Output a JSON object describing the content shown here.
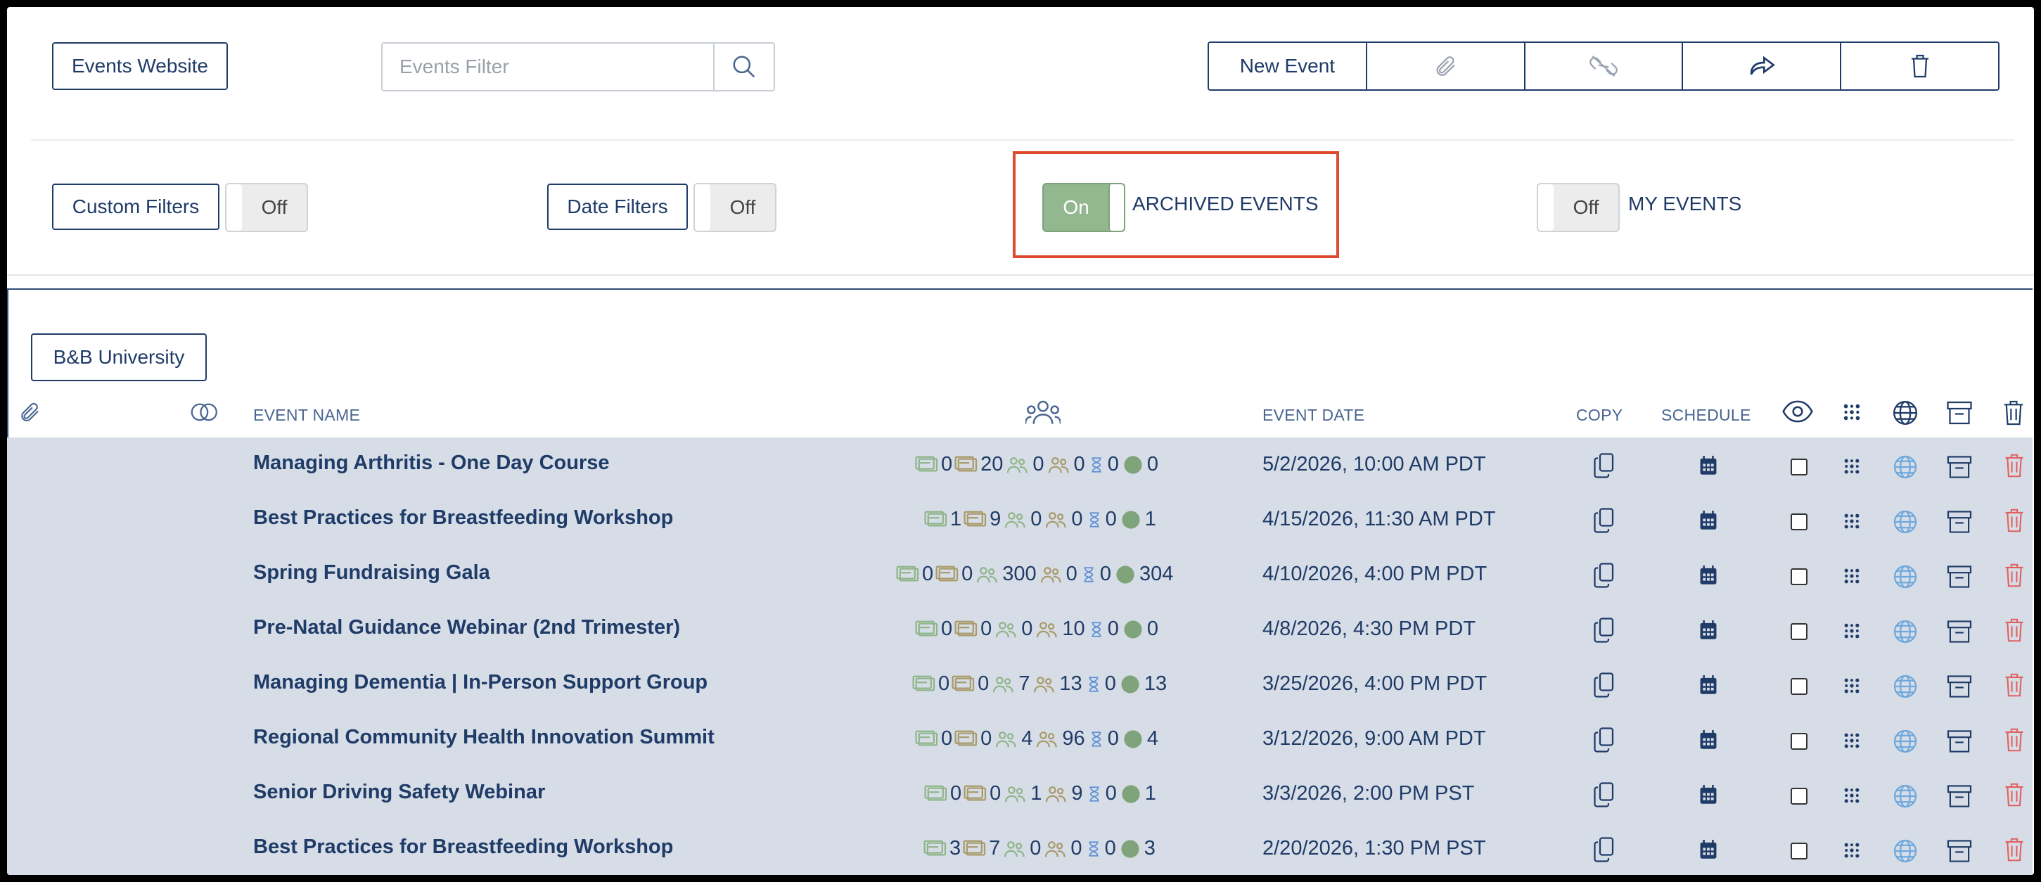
{
  "top": {
    "events_website_label": "Events Website",
    "filter_placeholder": "Events Filter",
    "new_event_label": "New Event"
  },
  "filters": {
    "custom_filters_label": "Custom Filters",
    "custom_filters_state": "Off",
    "date_filters_label": "Date Filters",
    "date_filters_state": "Off",
    "archived_state": "On",
    "archived_label": "ARCHIVED EVENTS",
    "my_events_state": "Off",
    "my_events_label": "MY EVENTS"
  },
  "org_button_label": "B&B University",
  "table": {
    "headers": {
      "event_name": "EVENT NAME",
      "event_date": "EVENT DATE",
      "copy": "COPY",
      "schedule": "SCHEDULE"
    },
    "rows": [
      {
        "name": "Managing Arthritis - One Day Course",
        "counts": [
          "0",
          "20",
          "0",
          "0",
          "0",
          "0"
        ],
        "date": "5/2/2026, 10:00 AM PDT"
      },
      {
        "name": "Best Practices for Breastfeeding Workshop",
        "counts": [
          "1",
          "9",
          "0",
          "0",
          "0",
          "1"
        ],
        "date": "4/15/2026, 11:30 AM PDT"
      },
      {
        "name": "Spring Fundraising Gala",
        "counts": [
          "0",
          "0",
          "300",
          "0",
          "0",
          "304"
        ],
        "date": "4/10/2026, 4:00 PM PDT"
      },
      {
        "name": "Pre-Natal Guidance Webinar (2nd Trimester)",
        "counts": [
          "0",
          "0",
          "0",
          "10",
          "0",
          "0"
        ],
        "date": "4/8/2026, 4:30 PM PDT"
      },
      {
        "name": "Managing Dementia | In-Person Support Group",
        "counts": [
          "0",
          "0",
          "7",
          "13",
          "0",
          "13"
        ],
        "date": "3/25/2026, 4:00 PM PDT"
      },
      {
        "name": "Regional Community Health Innovation Summit",
        "counts": [
          "0",
          "0",
          "4",
          "96",
          "0",
          "4"
        ],
        "date": "3/12/2026, 9:00 AM PDT"
      },
      {
        "name": "Senior Driving Safety Webinar",
        "counts": [
          "0",
          "0",
          "1",
          "9",
          "0",
          "1"
        ],
        "date": "3/3/2026, 2:00 PM PST"
      },
      {
        "name": "Best Practices for Breastfeeding Workshop",
        "counts": [
          "3",
          "7",
          "0",
          "0",
          "0",
          "3"
        ],
        "date": "2/20/2026, 1:30 PM PST"
      }
    ]
  },
  "colors": {
    "primary": "#1f3b68",
    "toggle_on": "#93b78f",
    "highlight_border": "#e04a2f",
    "row_bg": "#d7dde6",
    "globe": "#6fa8dc",
    "trash_row": "#e06060"
  },
  "icons": {
    "search": "search-icon",
    "attach": "paperclip-icon",
    "unlink": "unlink-icon",
    "share": "share-icon",
    "delete": "trash-icon"
  }
}
